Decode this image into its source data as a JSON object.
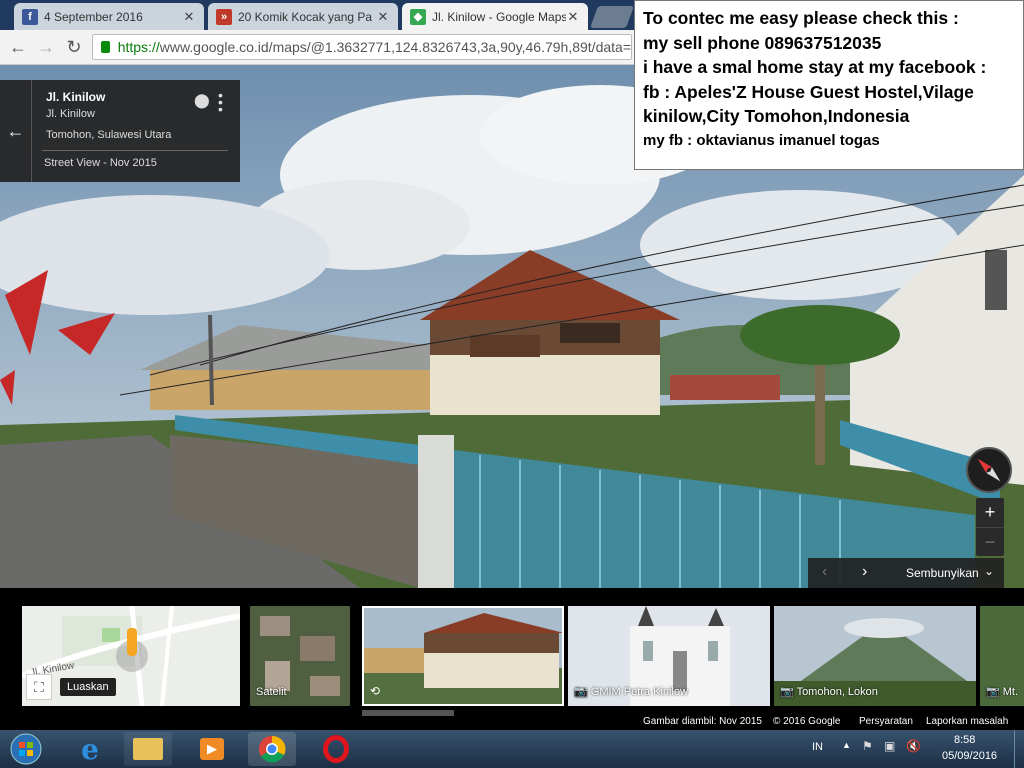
{
  "tabs": [
    {
      "title": "4 September 2016",
      "favicon": "facebook-icon",
      "color": "#3b5998",
      "glyph": "f"
    },
    {
      "title": "20 Komik Kocak yang Pa",
      "favicon": "news-icon",
      "color": "#c0392b",
      "glyph": "»"
    },
    {
      "title": "Jl. Kinilow - Google Maps",
      "favicon": "maps-icon",
      "color": "#34a853",
      "glyph": "◆"
    }
  ],
  "tab_close": "✕",
  "toolbar": {
    "url_secure": "https://",
    "url_rest": "www.google.co.id/maps/@1.3632771,124.8326743,3a,90y,46.79h,89t/data="
  },
  "note": {
    "lines": [
      "To contec me easy please check this :",
      "my sell phone 089637512035",
      "i have a smal home stay at my facebook :",
      "fb : Apeles'Z House Guest Hostel,Vilage",
      "kinilow,City Tomohon,Indonesia",
      "my fb : oktavianus  imanuel togas"
    ]
  },
  "info": {
    "title": "Jl. Kinilow",
    "subtitle": "Jl. Kinilow",
    "region": "Tomohon, Sulawesi Utara",
    "date": "Street View - Nov 2015"
  },
  "controls": {
    "zoom_in": "+",
    "zoom_out": "−",
    "hide_label": "Sembunyikan",
    "expand_label": "Luaskan"
  },
  "filmstrip": {
    "map_street": "Jl. Kinilow",
    "satellite_label": "Satelit",
    "photos": [
      {
        "label": "GMIM Petra Kinilow"
      },
      {
        "label": "Tomohon, Lokon"
      },
      {
        "label": "Mt."
      }
    ]
  },
  "footer": {
    "captured": "Gambar diambil: Nov 2015",
    "copyright": "© 2016 Google",
    "terms": "Persyaratan",
    "report": "Laporkan masalah"
  },
  "tray": {
    "lang": "IN",
    "time": "8:58",
    "date": "05/09/2016"
  }
}
